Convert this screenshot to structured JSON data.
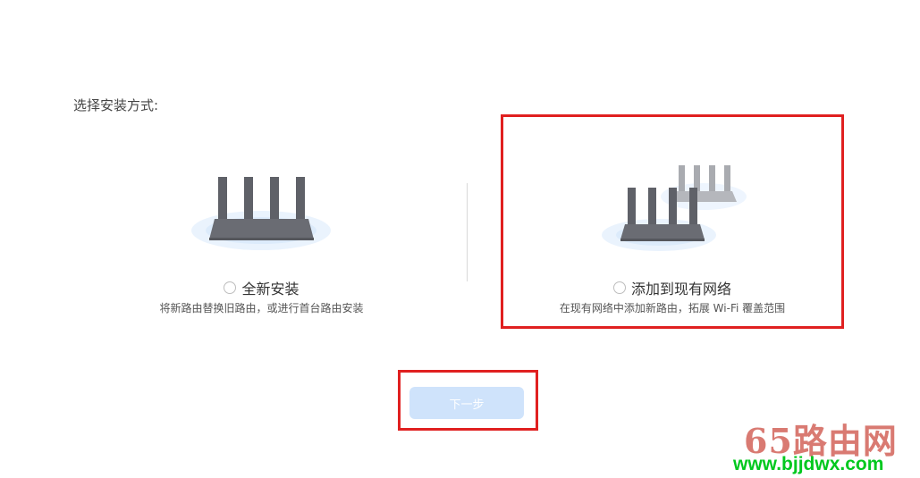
{
  "page": {
    "title": "选择安装方式:"
  },
  "options": [
    {
      "label": "全新安装",
      "description": "将新路由替换旧路由，或进行首台路由安装",
      "selected": false
    },
    {
      "label": "添加到现有网络",
      "description": "在现有网络中添加新路由，拓展 Wi-Fi 覆盖范围",
      "selected": false
    }
  ],
  "next_button": {
    "label": "下一步",
    "enabled": false
  },
  "watermark": {
    "text": "65路由网",
    "url": "www.bjjdwx.com"
  },
  "colors": {
    "highlight_border": "#e02020",
    "button_disabled": "#cfe3fb",
    "router_body": "#5f6168",
    "router_secondary": "#a9abb0",
    "glow": "#dcebfb",
    "watermark_text": "#d97a72",
    "watermark_url": "#00c81e"
  }
}
